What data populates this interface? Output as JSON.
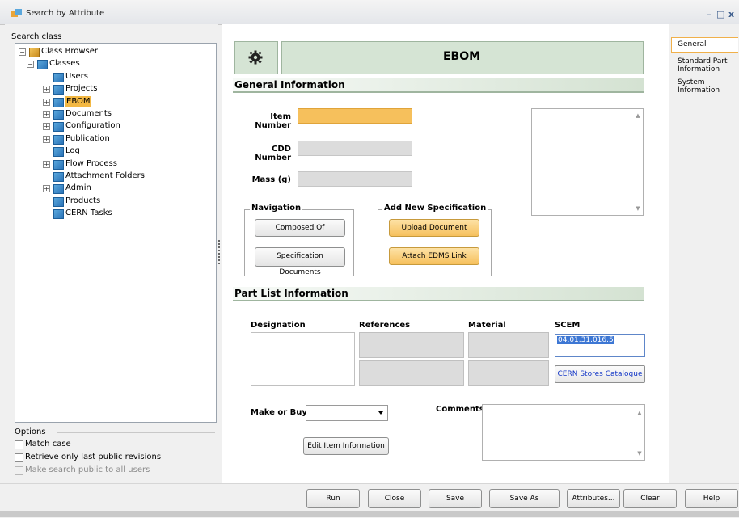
{
  "window": {
    "title": "Search by Attribute",
    "controls": {
      "minimize": "–",
      "maximize": "□",
      "close": "x"
    }
  },
  "left": {
    "search_class_label": "Search class",
    "tree": [
      {
        "label": "Class Browser",
        "level": 0,
        "expander": "−"
      },
      {
        "label": "Classes",
        "level": 1,
        "expander": "−"
      },
      {
        "label": "Users",
        "level": 2,
        "expander": ""
      },
      {
        "label": "Projects",
        "level": 2,
        "expander": "+"
      },
      {
        "label": "EBOM",
        "level": 2,
        "expander": "+",
        "selected": true
      },
      {
        "label": "Documents",
        "level": 2,
        "expander": "+"
      },
      {
        "label": "Configuration",
        "level": 2,
        "expander": "+"
      },
      {
        "label": "Publication",
        "level": 2,
        "expander": "+"
      },
      {
        "label": "Log",
        "level": 2,
        "expander": ""
      },
      {
        "label": "Flow Process",
        "level": 2,
        "expander": "+"
      },
      {
        "label": "Attachment Folders",
        "level": 2,
        "expander": ""
      },
      {
        "label": "Admin",
        "level": 2,
        "expander": "+"
      },
      {
        "label": "Products",
        "level": 2,
        "expander": ""
      },
      {
        "label": "CERN Tasks",
        "level": 2,
        "expander": ""
      }
    ],
    "options": {
      "label": "Options",
      "match_case": "Match case",
      "last_public": "Retrieve only last public revisions",
      "make_public": "Make search public to all users"
    }
  },
  "form": {
    "title": "EBOM",
    "general_info": "General Information",
    "item_number_label": "Item Number",
    "cdd_number_label": "CDD Number",
    "mass_label": "Mass (g)",
    "navigation": {
      "title": "Navigation",
      "composed_of": "Composed Of",
      "spec_docs": "Specification Documents"
    },
    "add_spec": {
      "title": "Add New Specification",
      "upload": "Upload Document",
      "attach_edms": "Attach EDMS Link"
    },
    "part_list": "Part List Information",
    "columns": {
      "designation": "Designation",
      "references": "References",
      "material": "Material",
      "scem": "SCEM"
    },
    "scem_value": "04.01.31.016.5",
    "cern_catalogue": "CERN Stores Catalogue",
    "make_or_buy_label": "Make or Buy",
    "make_or_buy_value": "",
    "comments_label": "Comments",
    "edit_item_info": "Edit Item Information"
  },
  "right_tabs": {
    "general": "General",
    "standard_part": [
      "Standard Part",
      "Information"
    ],
    "system": [
      "System",
      "Information"
    ]
  },
  "bottom": {
    "run": "Run",
    "close": "Close",
    "save": "Save",
    "save_as": "Save As",
    "attributes": "Attributes...",
    "clear": "Clear",
    "help": "Help"
  },
  "colors": {
    "section_green": "#d5e4d4",
    "highlight_orange": "#f6c05c",
    "selection": "#3d77d4"
  }
}
